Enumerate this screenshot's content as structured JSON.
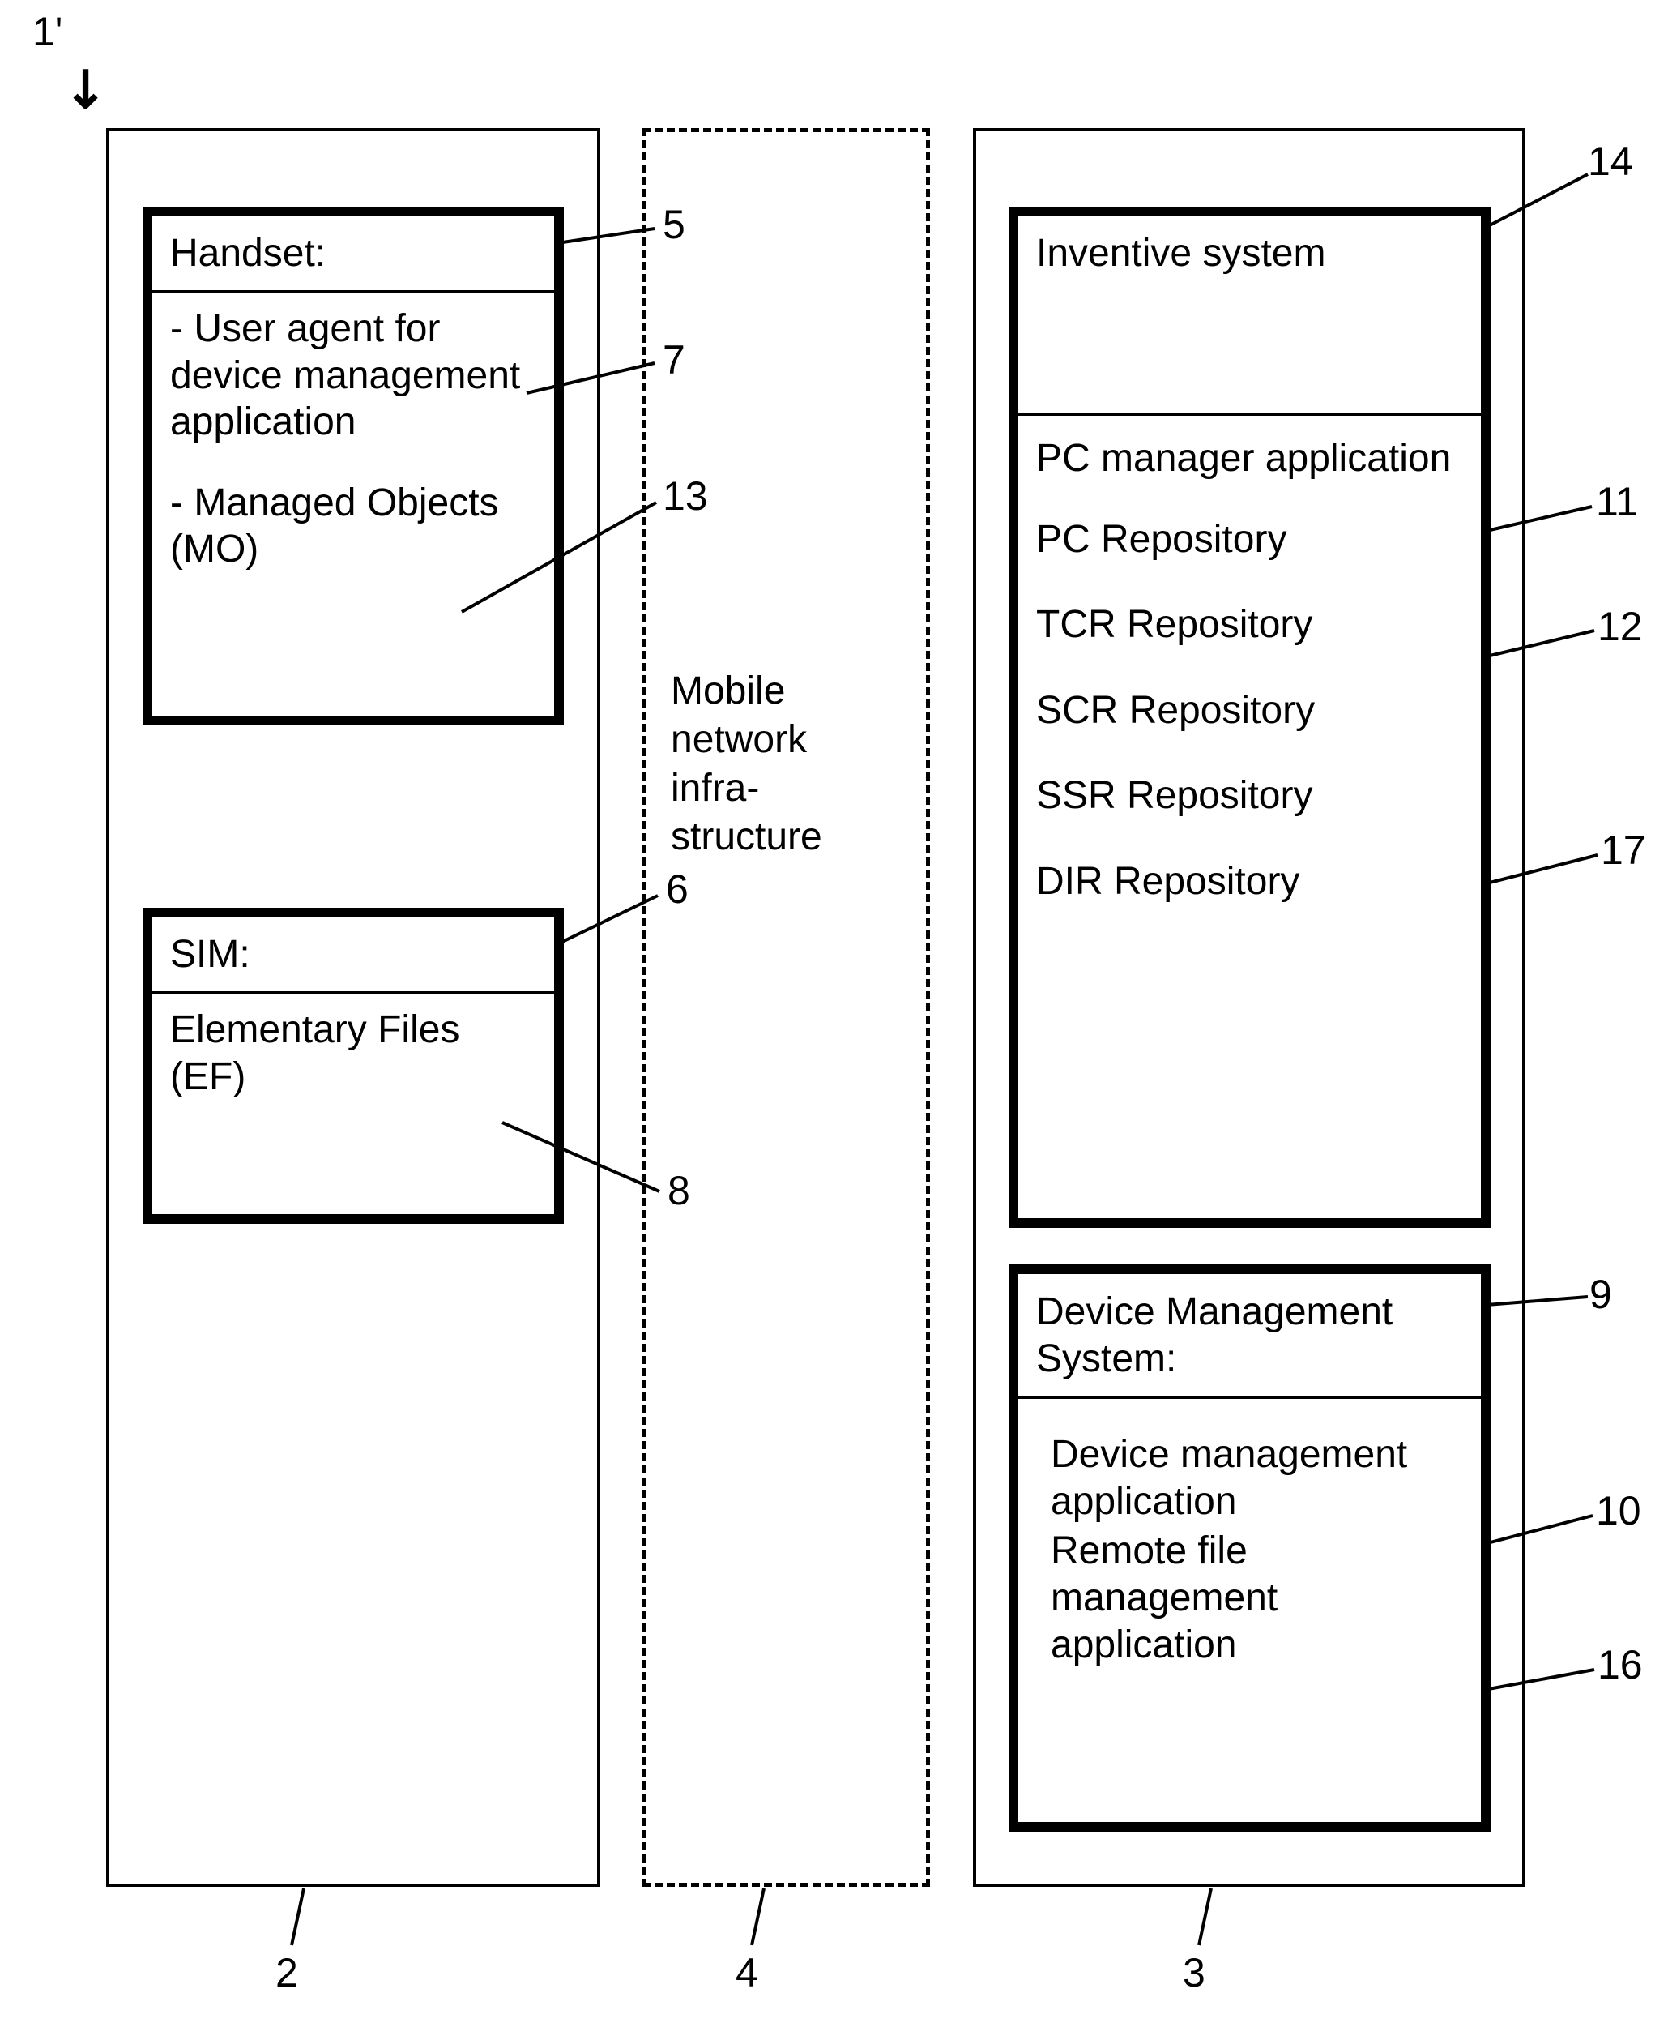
{
  "figure_ref": "1'",
  "columns": {
    "left": {
      "ref": "2"
    },
    "middle": {
      "ref": "4",
      "text": "Mobile network infra-structure"
    },
    "right": {
      "ref": "3"
    }
  },
  "handset": {
    "ref": "5",
    "title": "Handset:",
    "items": {
      "user_agent": {
        "text": "- User agent for device management application",
        "ref": "7"
      },
      "mo": {
        "text": "- Managed Objects (MO)",
        "ref": "13"
      }
    }
  },
  "sim": {
    "ref": "6",
    "title": "SIM:",
    "items": {
      "ef": {
        "text": "Elementary Files (EF)",
        "ref": "8"
      }
    }
  },
  "inventive": {
    "ref": "14",
    "title": "Inventive system",
    "items": {
      "pc_mgr": {
        "text": "PC manager application",
        "ref": "11"
      },
      "pc_repo": {
        "text": "PC Repository",
        "ref": "12"
      },
      "tcr_repo": {
        "text": "TCR Repository",
        "ref": ""
      },
      "scr_repo": {
        "text": "SCR Repository",
        "ref": "17"
      },
      "ssr_repo": {
        "text": "SSR Repository",
        "ref": ""
      },
      "dir_repo": {
        "text": "DIR Repository",
        "ref": ""
      }
    }
  },
  "dms": {
    "ref": "9",
    "title": "Device Management System:",
    "items": {
      "dma": {
        "text": "Device management application",
        "ref": "10"
      },
      "rfma": {
        "text": "Remote file management application",
        "ref": "16"
      }
    }
  }
}
